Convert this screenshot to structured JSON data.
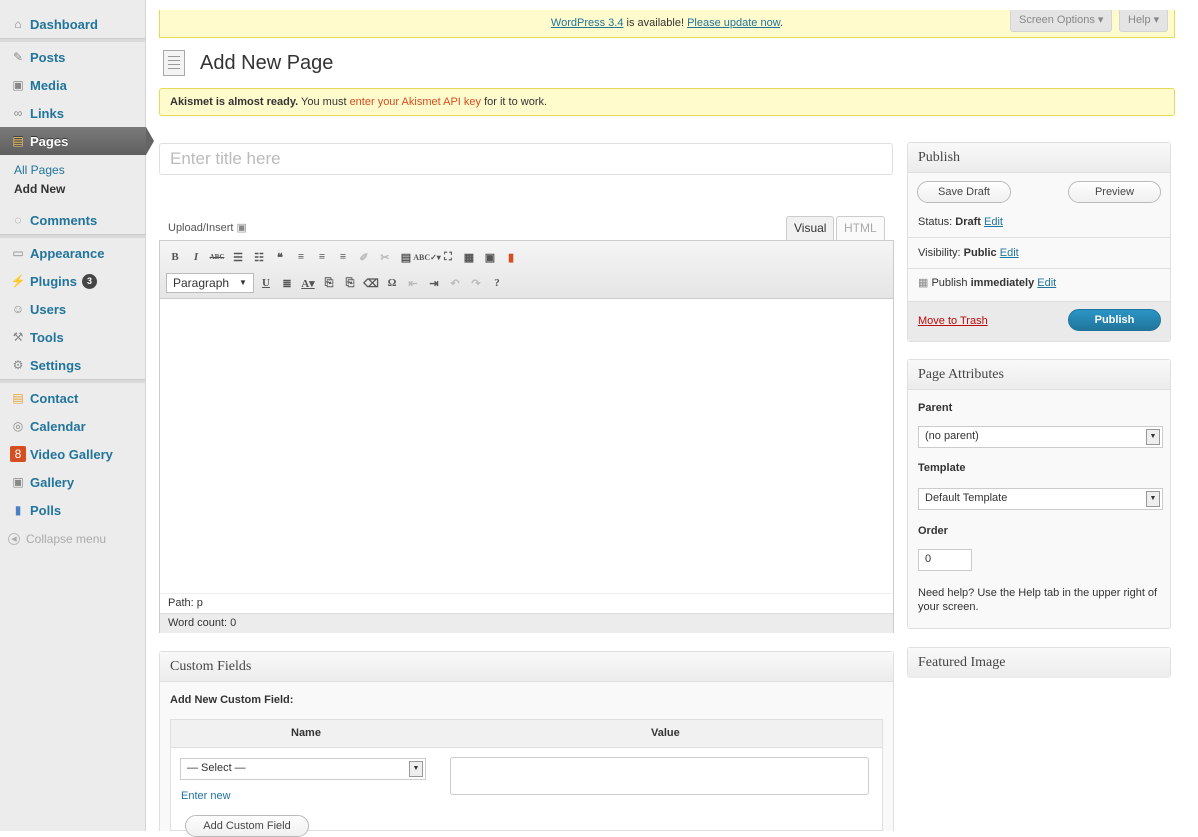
{
  "sidebar": {
    "dashboard": "Dashboard",
    "posts": "Posts",
    "media": "Media",
    "links": "Links",
    "pages": "Pages",
    "all_pages": "All Pages",
    "add_new": "Add New",
    "comments": "Comments",
    "appearance": "Appearance",
    "plugins": "Plugins",
    "plugins_badge": "3",
    "users": "Users",
    "tools": "Tools",
    "settings": "Settings",
    "contact": "Contact",
    "calendar": "Calendar",
    "video_gallery": "Video Gallery",
    "gallery": "Gallery",
    "polls": "Polls",
    "collapse": "Collapse menu"
  },
  "notice": {
    "version_link": "WordPress 3.4",
    "mid": " is available! ",
    "update_link": "Please update now",
    "end": "."
  },
  "header": {
    "screen_options": "Screen Options ▾",
    "help": "Help ▾",
    "title": "Add New Page"
  },
  "akismet": {
    "bold": "Akismet is almost ready.",
    "text1": " You must ",
    "link": "enter your Akismet API key",
    "text2": " for it to work."
  },
  "editor": {
    "title_placeholder": "Enter title here",
    "upload": "Upload/Insert",
    "tab_visual": "Visual",
    "tab_html": "HTML",
    "format": "Paragraph",
    "path": "Path: p",
    "word_count": "Word count: 0"
  },
  "publish": {
    "title": "Publish",
    "save_draft": "Save Draft",
    "preview": "Preview",
    "status_label": "Status: ",
    "status": "Draft",
    "edit": "Edit",
    "visibility_label": "Visibility: ",
    "visibility": "Public",
    "publish_label": "Publish ",
    "publish_when": "immediately",
    "trash": "Move to Trash",
    "publish_btn": "Publish"
  },
  "attributes": {
    "title": "Page Attributes",
    "parent_label": "Parent",
    "parent_value": "(no parent)",
    "template_label": "Template",
    "template_value": "Default Template",
    "order_label": "Order",
    "order_value": "0",
    "help": "Need help? Use the Help tab in the upper right of your screen."
  },
  "featured": {
    "title": "Featured Image"
  },
  "custom": {
    "title": "Custom Fields",
    "subtitle": "Add New Custom Field:",
    "col_name": "Name",
    "col_value": "Value",
    "select": "— Select —",
    "enter_new": "Enter new",
    "add_btn": "Add Custom Field"
  }
}
